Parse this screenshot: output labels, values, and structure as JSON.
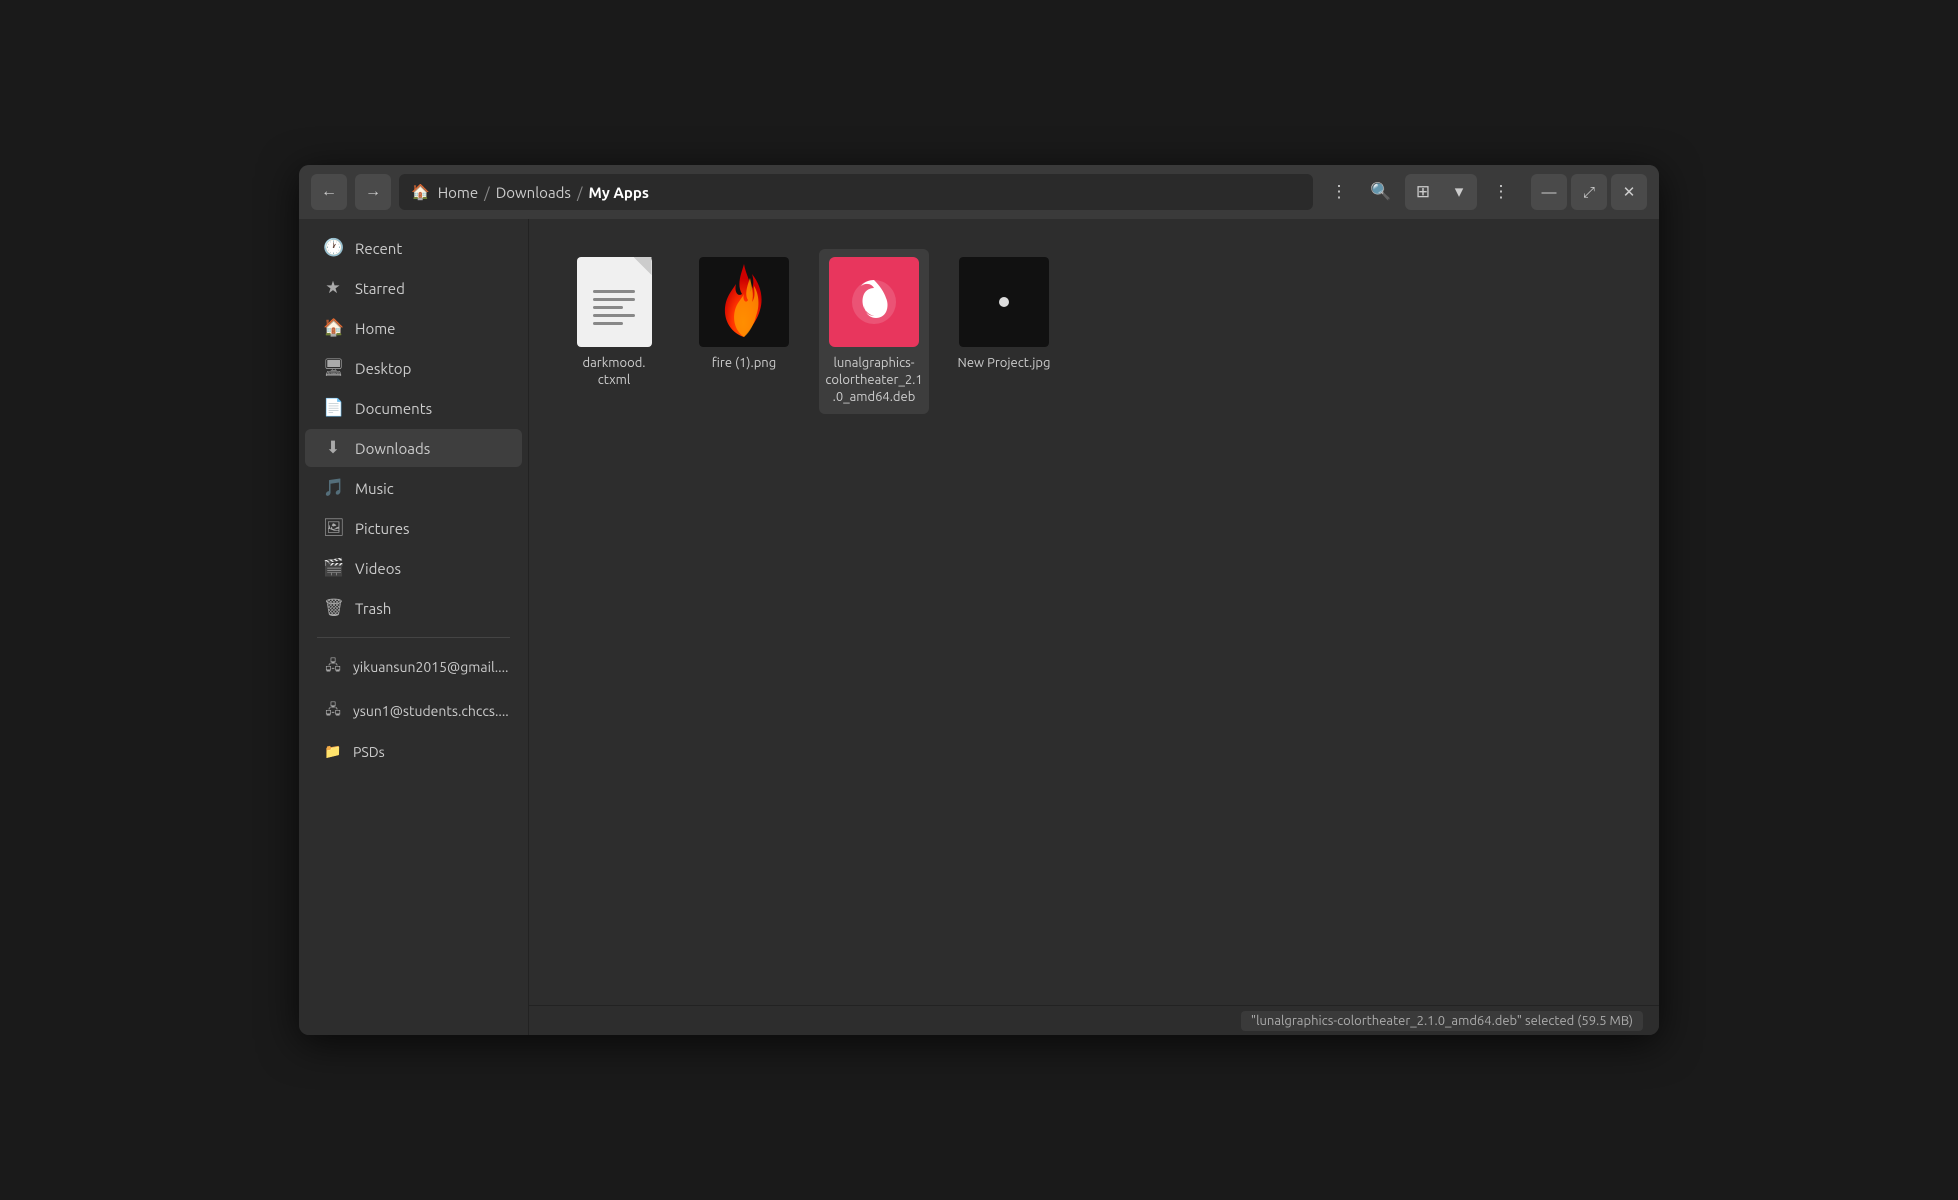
{
  "window": {
    "title": "My Apps"
  },
  "titlebar": {
    "back_label": "←",
    "forward_label": "→",
    "breadcrumb": {
      "home_label": "Home",
      "sep1": "/",
      "downloads_label": "Downloads",
      "sep2": "/",
      "myapps_label": "My Apps"
    },
    "menu_btn_label": "⋮",
    "search_btn_label": "🔍",
    "view_grid_label": "⊞",
    "view_chevron_label": "▾",
    "more_label": "⋮",
    "minimize_label": "—",
    "maximize_label": "⤢",
    "close_label": "✕"
  },
  "sidebar": {
    "items": [
      {
        "id": "recent",
        "label": "Recent",
        "icon": "🕐"
      },
      {
        "id": "starred",
        "label": "Starred",
        "icon": "★"
      },
      {
        "id": "home",
        "label": "Home",
        "icon": "🏠"
      },
      {
        "id": "desktop",
        "label": "Desktop",
        "icon": "🖥"
      },
      {
        "id": "documents",
        "label": "Documents",
        "icon": "📄"
      },
      {
        "id": "downloads",
        "label": "Downloads",
        "icon": "⬇"
      },
      {
        "id": "music",
        "label": "Music",
        "icon": "🎵"
      },
      {
        "id": "pictures",
        "label": "Pictures",
        "icon": "🖼"
      },
      {
        "id": "videos",
        "label": "Videos",
        "icon": "🎬"
      },
      {
        "id": "trash",
        "label": "Trash",
        "icon": "🗑"
      }
    ],
    "drives": [
      {
        "id": "drive1",
        "label": "yikuansun2015@gmail...."
      },
      {
        "id": "drive2",
        "label": "ysun1@students.chccs...."
      },
      {
        "id": "drive3",
        "label": "PSDs"
      }
    ]
  },
  "files": [
    {
      "id": "darkmood",
      "name": "darkmood.\nctxml",
      "type": "doc",
      "selected": false
    },
    {
      "id": "fire",
      "name": "fire (1).png",
      "type": "fire-png",
      "selected": false
    },
    {
      "id": "lunalgraphics",
      "name": "lunalgraphics-colortheater_2.1.0_amd64.deb",
      "type": "deb",
      "selected": true
    },
    {
      "id": "newproject",
      "name": "New Project.jpg",
      "type": "jpg",
      "selected": false
    }
  ],
  "statusbar": {
    "text": "\"lunalgraphics-colortheater_2.1.0_amd64.deb\" selected (59.5 MB)"
  }
}
